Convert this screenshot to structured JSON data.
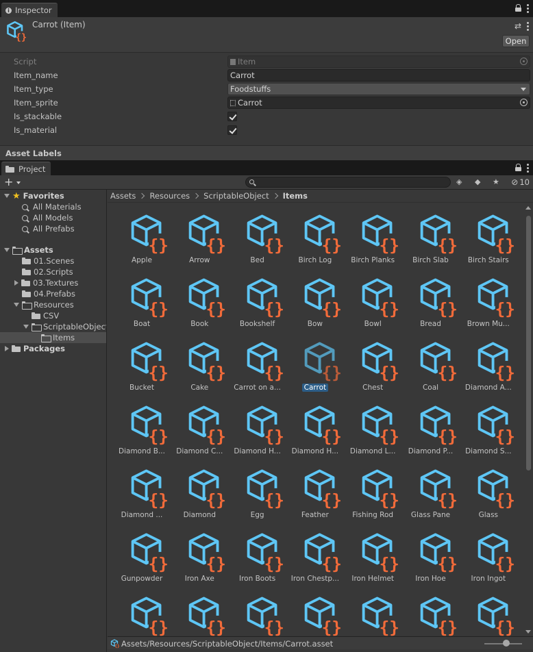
{
  "inspector": {
    "tab_label": "Inspector",
    "title": "Carrot (Item)",
    "open_label": "Open",
    "properties": [
      {
        "label": "Script",
        "value": "Item",
        "kind": "object-disabled"
      },
      {
        "label": "Item_name",
        "value": "Carrot",
        "kind": "text"
      },
      {
        "label": "Item_type",
        "value": "Foodstuffs",
        "kind": "dropdown"
      },
      {
        "label": "Item_sprite",
        "value": "Carrot",
        "kind": "object"
      },
      {
        "label": "Is_stackable",
        "value": true,
        "kind": "checkbox"
      },
      {
        "label": "Is_material",
        "value": true,
        "kind": "checkbox"
      }
    ],
    "asset_labels": "Asset Labels"
  },
  "project": {
    "tab_label": "Project",
    "search_placeholder": "",
    "hidden_count": "10",
    "tree": [
      {
        "label": "Favorites",
        "indent": 0,
        "arrow": "down",
        "icon": "star-icon",
        "bold": true
      },
      {
        "label": "All Materials",
        "indent": 1,
        "arrow": "none",
        "icon": "search-icon"
      },
      {
        "label": "All Models",
        "indent": 1,
        "arrow": "none",
        "icon": "search-icon"
      },
      {
        "label": "All Prefabs",
        "indent": 1,
        "arrow": "none",
        "icon": "search-icon"
      },
      {
        "label": "",
        "indent": 0,
        "arrow": "spacer",
        "icon": "none"
      },
      {
        "label": "Assets",
        "indent": 0,
        "arrow": "down",
        "icon": "folder-open-icon",
        "bold": true
      },
      {
        "label": "01.Scenes",
        "indent": 1,
        "arrow": "none",
        "icon": "folder-icon"
      },
      {
        "label": "02.Scripts",
        "indent": 1,
        "arrow": "none",
        "icon": "folder-icon"
      },
      {
        "label": "03.Textures",
        "indent": 1,
        "arrow": "right",
        "icon": "folder-icon"
      },
      {
        "label": "04.Prefabs",
        "indent": 1,
        "arrow": "none",
        "icon": "folder-icon"
      },
      {
        "label": "Resources",
        "indent": 1,
        "arrow": "down",
        "icon": "folder-open-icon"
      },
      {
        "label": "CSV",
        "indent": 2,
        "arrow": "none",
        "icon": "folder-icon"
      },
      {
        "label": "ScriptableObject",
        "indent": 2,
        "arrow": "down",
        "icon": "folder-open-icon"
      },
      {
        "label": "Items",
        "indent": 3,
        "arrow": "none",
        "icon": "folder-open-icon",
        "selected": true
      },
      {
        "label": "Packages",
        "indent": 0,
        "arrow": "right",
        "icon": "folder-icon",
        "bold": true
      }
    ],
    "breadcrumb": [
      "Assets",
      "Resources",
      "ScriptableObject",
      "Items"
    ],
    "items": [
      "Apple",
      "Arrow",
      "Bed",
      "Birch Log",
      "Birch Planks",
      "Birch Slab",
      "Birch Stairs",
      "Boat",
      "Book",
      "Bookshelf",
      "Bow",
      "Bowl",
      "Bread",
      "Brown Mu...",
      "Bucket",
      "Cake",
      "Carrot on a...",
      "Carrot",
      "Chest",
      "Coal",
      "Diamond A...",
      "Diamond B...",
      "Diamond C...",
      "Diamond H...",
      "Diamond H...",
      "Diamond L...",
      "Diamond P...",
      "Diamond S...",
      "Diamond ...",
      "Diamond",
      "Egg",
      "Feather",
      "Fishing Rod",
      "Glass Pane",
      "Glass",
      "Gunpowder",
      "Iron Axe",
      "Iron Boots",
      "Iron Chestp...",
      "Iron Helmet",
      "Iron Hoe",
      "Iron Ingot",
      "",
      "",
      "",
      "",
      "",
      "",
      ""
    ],
    "selected_item": "Carrot",
    "status_path": "Assets/Resources/ScriptableObject/Items/Carrot.asset",
    "zoom": 0.5
  },
  "colors": {
    "icon_blue": "#5ec6f5",
    "icon_orange": "#f26b3a",
    "selection": "#2c5d87"
  }
}
